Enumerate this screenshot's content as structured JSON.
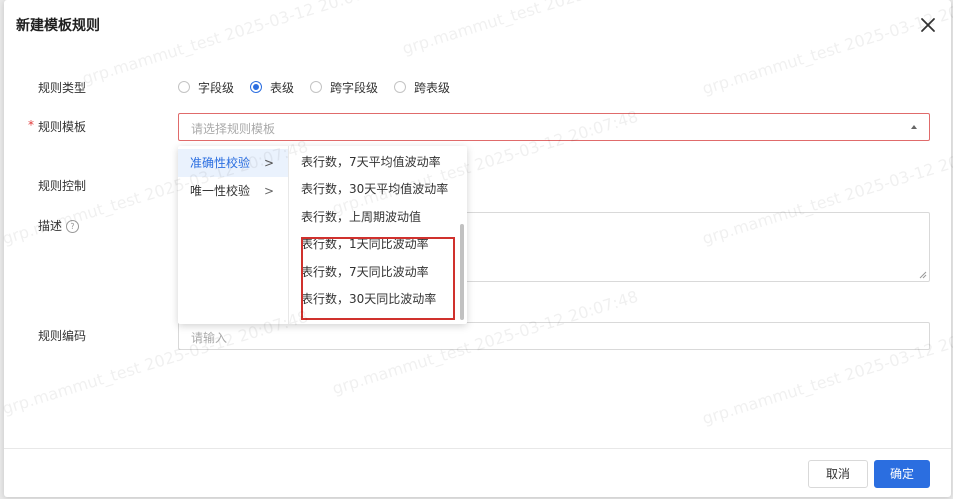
{
  "dialog": {
    "title": "新建模板规则"
  },
  "form": {
    "rule_type": {
      "label": "规则类型",
      "options": [
        {
          "label": "字段级",
          "checked": false
        },
        {
          "label": "表级",
          "checked": true
        },
        {
          "label": "跨字段级",
          "checked": false
        },
        {
          "label": "跨表级",
          "checked": false
        }
      ]
    },
    "rule_template": {
      "label": "规则模板",
      "required_mark": "*",
      "placeholder": "请选择规则模板"
    },
    "rule_control": {
      "label": "规则控制"
    },
    "description": {
      "label": "描述",
      "help_icon": "?"
    },
    "rule_code": {
      "label": "规则编码",
      "placeholder": "请输入"
    }
  },
  "cascader": {
    "level1": [
      {
        "label": "准确性校验",
        "active": true
      },
      {
        "label": "唯一性校验",
        "active": false
      }
    ],
    "level2": [
      "表行数，7天平均值波动率",
      "表行数，30天平均值波动率",
      "表行数，上周期波动值",
      "表行数，1天同比波动率",
      "表行数，7天同比波动率",
      "表行数，30天同比波动率"
    ],
    "chevron": ">"
  },
  "footer": {
    "cancel_label": "取消",
    "ok_label": "确定"
  },
  "watermark": "grp.mammut_test 2025-03-12 20:07:48",
  "colors": {
    "primary": "#2b6ee0",
    "error_border": "#e06b6b",
    "annotation": "#d0312d"
  }
}
